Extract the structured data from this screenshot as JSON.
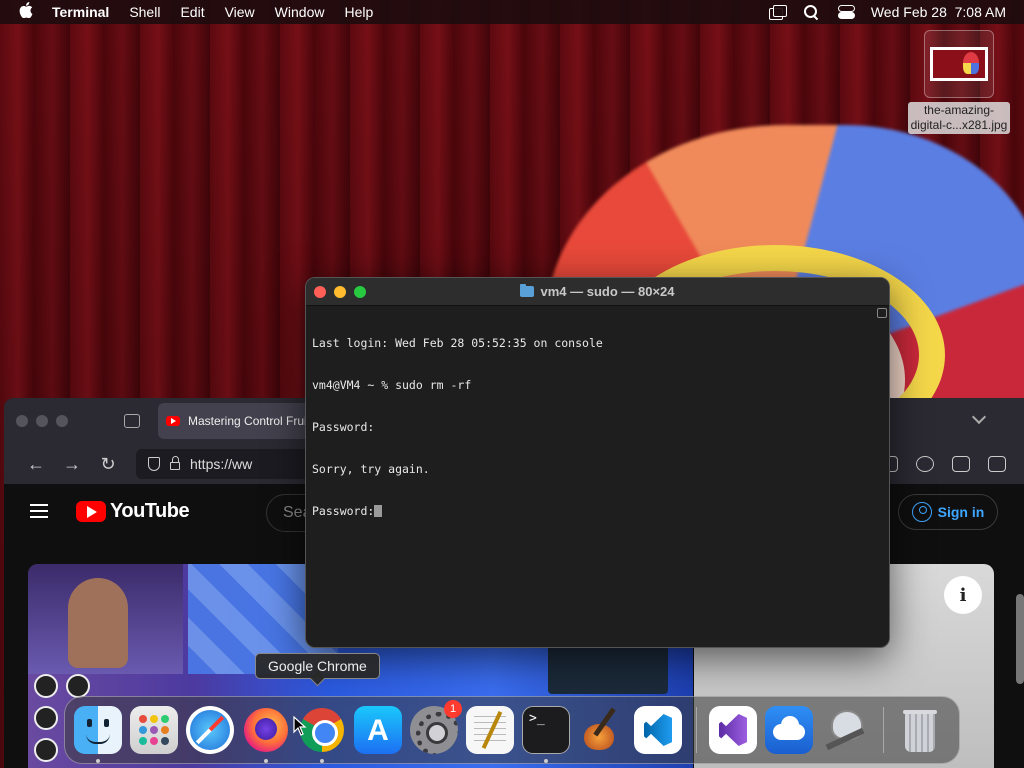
{
  "menubar": {
    "app_name": "Terminal",
    "items": [
      "Shell",
      "Edit",
      "View",
      "Window",
      "Help"
    ],
    "datetime": "Wed Feb 28  7:08 AM"
  },
  "desktop_file": {
    "name_line1": "the-amazing-",
    "name_line2": "digital-c...x281.jpg"
  },
  "browser": {
    "tab_title": "Mastering Control Frui",
    "url": "https://ww",
    "youtube": {
      "logo_text": "YouTube",
      "search_placeholder": "Sea",
      "sign_in_label": "Sign in",
      "info_glyph": "i"
    }
  },
  "terminal": {
    "title": "vm4 — sudo — 80×24",
    "lines": [
      "Last login: Wed Feb 28 05:52:35 on console",
      "vm4@VM4 ~ % sudo rm -rf",
      "Password:",
      "Sorry, try again.",
      "Password:"
    ]
  },
  "tooltip": {
    "text": "Google Chrome"
  },
  "dock": {
    "settings_badge": "1"
  }
}
